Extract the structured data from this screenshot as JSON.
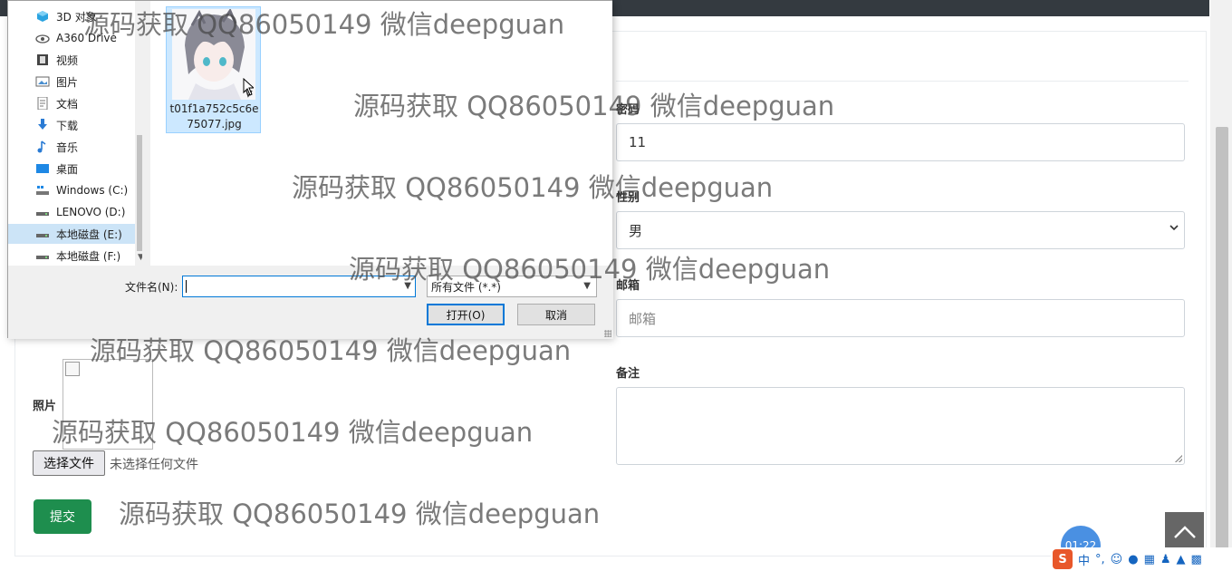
{
  "form": {
    "password_label": "密码",
    "password_value": "11",
    "gender_label": "性别",
    "gender_value": "男",
    "email_label": "邮箱",
    "email_placeholder": "邮箱",
    "note_label": "备注",
    "photo_label": "照片",
    "file_button": "选择文件",
    "file_status": "未选择任何文件",
    "submit": "提交"
  },
  "dialog": {
    "nav_items": [
      {
        "label": "3D 对象",
        "icon": "3d-objects-icon"
      },
      {
        "label": "A360 Drive",
        "icon": "cloud-drive-icon"
      },
      {
        "label": "视频",
        "icon": "video-folder-icon"
      },
      {
        "label": "图片",
        "icon": "pictures-folder-icon"
      },
      {
        "label": "文档",
        "icon": "documents-folder-icon"
      },
      {
        "label": "下载",
        "icon": "downloads-folder-icon"
      },
      {
        "label": "音乐",
        "icon": "music-folder-icon"
      },
      {
        "label": "桌面",
        "icon": "desktop-folder-icon"
      },
      {
        "label": "Windows (C:)",
        "icon": "system-drive-icon"
      },
      {
        "label": "LENOVO (D:)",
        "icon": "drive-icon"
      },
      {
        "label": "本地磁盘 (E:)",
        "icon": "drive-icon",
        "selected": true
      },
      {
        "label": "本地磁盘 (F:)",
        "icon": "drive-icon"
      }
    ],
    "file_name_line1": "t01f1a752c5c6e",
    "file_name_line2": "75077.jpg",
    "filename_label": "文件名(N):",
    "filename_value": "",
    "filetype": "所有文件 (*.*)",
    "open": "打开(O)",
    "cancel": "取消"
  },
  "watermark": "源码获取 QQ86050149 微信deepguan",
  "clock": "01:22",
  "ime": {
    "lang": "中"
  },
  "colors": {
    "primary": "#1e8e4e",
    "dialog_bg": "#f0f0f0",
    "selection": "#cce4f7",
    "accent_blue": "#0078d7"
  }
}
